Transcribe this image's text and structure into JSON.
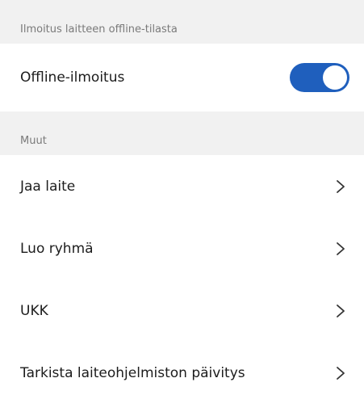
{
  "sections": {
    "offline_header": "Ilmoitus laitteen offline-tilasta",
    "offline_toggle": {
      "label": "Offline-ilmoitus",
      "state": "on"
    },
    "other_header": "Muut",
    "items": [
      {
        "label": "Jaa laite",
        "icon": "chevron-right-icon"
      },
      {
        "label": "Luo ryhmä",
        "icon": "chevron-right-icon"
      },
      {
        "label": "UKK",
        "icon": "chevron-right-icon"
      },
      {
        "label": "Tarkista laiteohjelmiston päivitys",
        "icon": "chevron-right-icon"
      }
    ]
  },
  "colors": {
    "accent": "#1f5fbd",
    "section_background": "#f1f1f1",
    "section_text": "#7a7a7a"
  }
}
